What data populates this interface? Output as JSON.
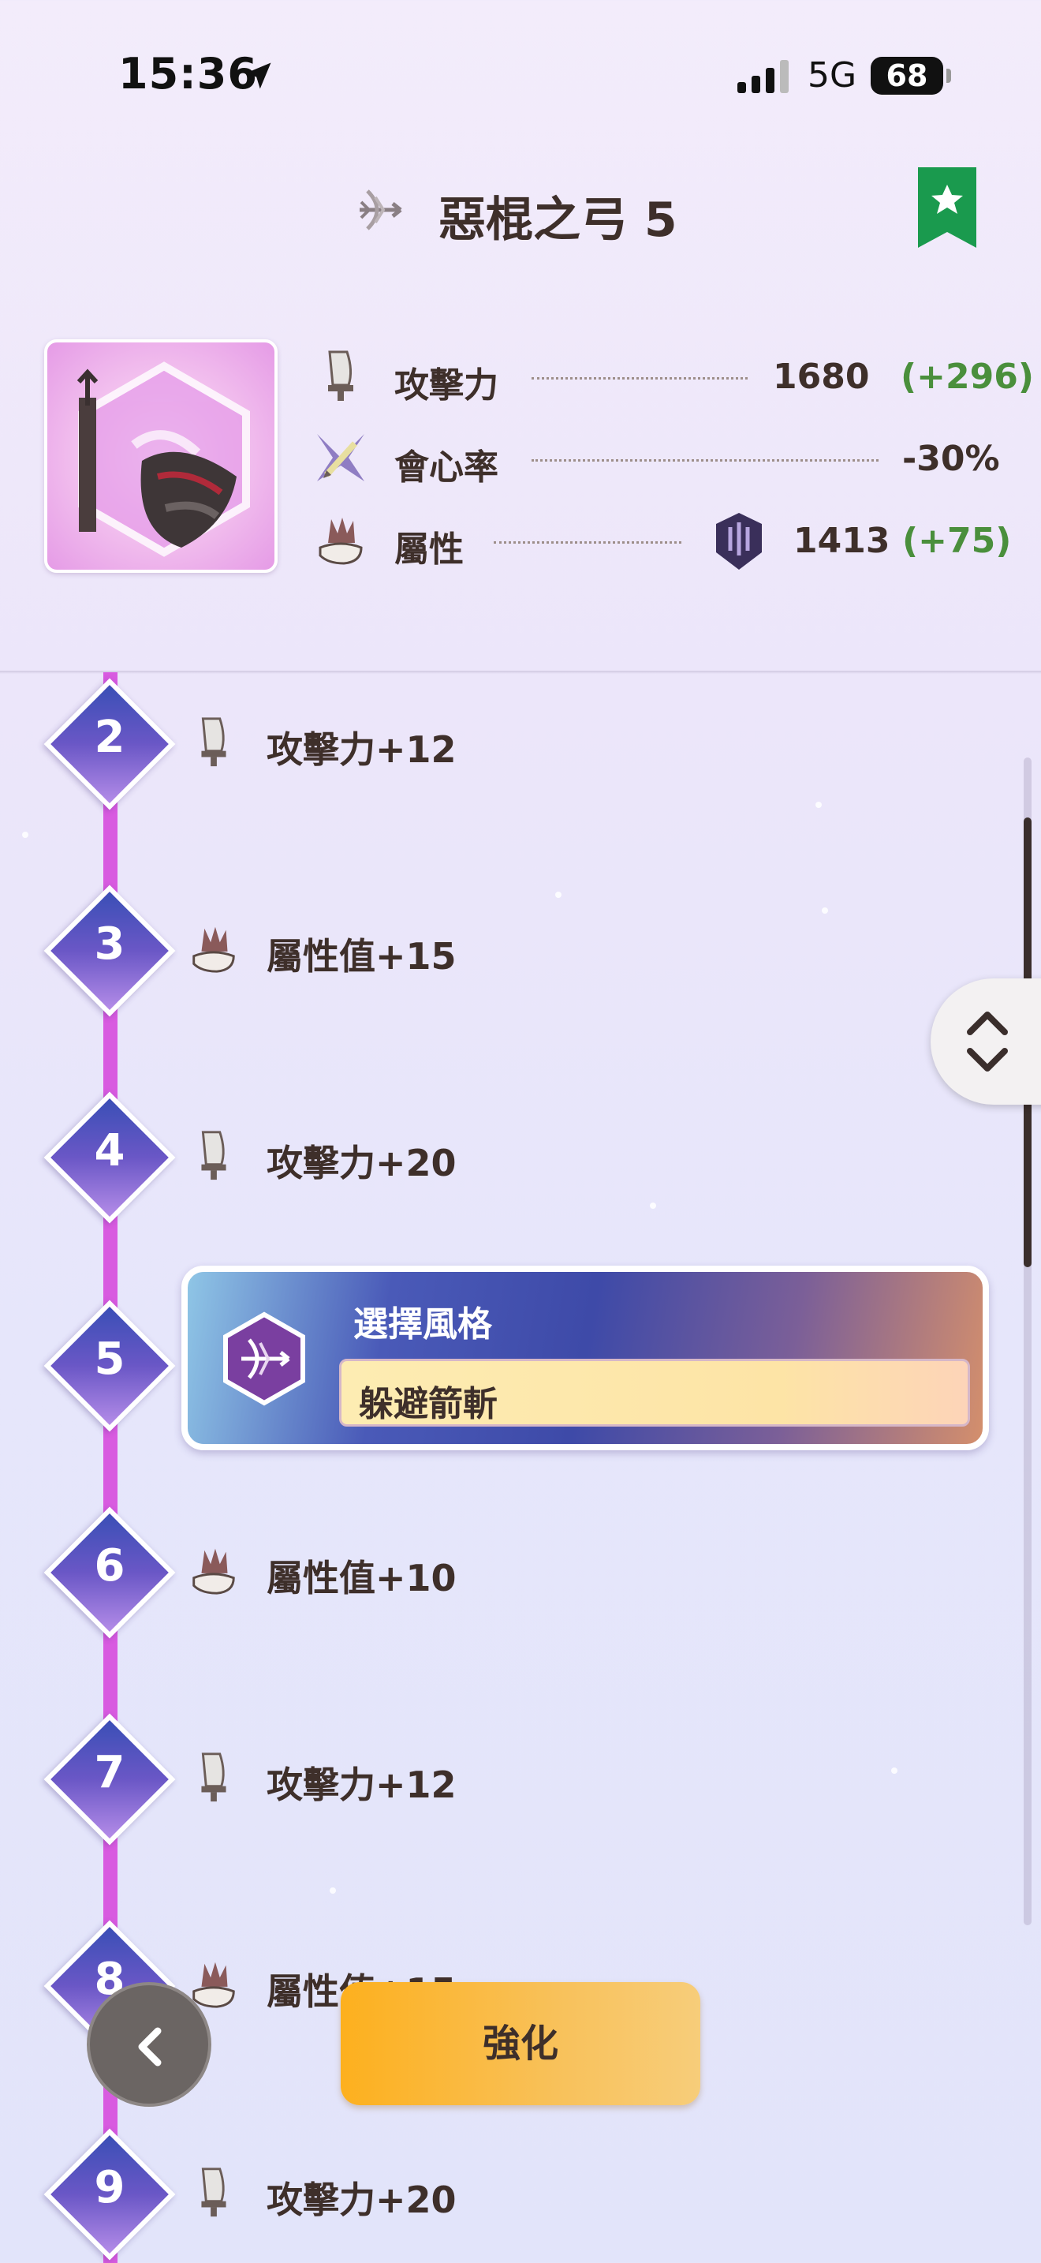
{
  "status_bar": {
    "time": "15:36",
    "network": "5G",
    "battery": "68"
  },
  "header": {
    "title": "惡棍之弓 5",
    "weapon_icon": "bow-icon",
    "bookmark_icon": "star-bookmark-icon"
  },
  "stats": {
    "attack": {
      "label": "攻擊力",
      "value": "1680",
      "bonus": "(+296)",
      "icon": "attack-blade-icon"
    },
    "affinity": {
      "label": "會心率",
      "value": "-30%",
      "icon": "affinity-icon"
    },
    "element": {
      "label": "屬性",
      "value": "1413",
      "bonus": "(+75)",
      "icon": "element-claw-icon",
      "type_icon": "dragon-element-icon"
    }
  },
  "timeline": [
    {
      "level": "2",
      "text": "攻擊力+12",
      "icon": "attack-blade-icon"
    },
    {
      "level": "3",
      "text": "屬性值+15",
      "icon": "element-claw-icon"
    },
    {
      "level": "4",
      "text": "攻擊力+20",
      "icon": "attack-blade-icon"
    },
    {
      "level": "5",
      "text": "",
      "icon": ""
    },
    {
      "level": "6",
      "text": "屬性值+10",
      "icon": "element-claw-icon"
    },
    {
      "level": "7",
      "text": "攻擊力+12",
      "icon": "attack-blade-icon"
    },
    {
      "level": "8",
      "text": "屬性值+15",
      "icon": "element-claw-icon"
    },
    {
      "level": "9",
      "text": "攻擊力+20",
      "icon": "attack-blade-icon"
    }
  ],
  "style_select": {
    "title": "選擇風格",
    "value": "躲避箭斬"
  },
  "buttons": {
    "enhance": "強化"
  },
  "colors": {
    "timeline": "#d85be0",
    "bonus_green": "#4a8f3c",
    "bookmark_green": "#1a9a4e",
    "enhance_orange": "#fdb01e"
  }
}
